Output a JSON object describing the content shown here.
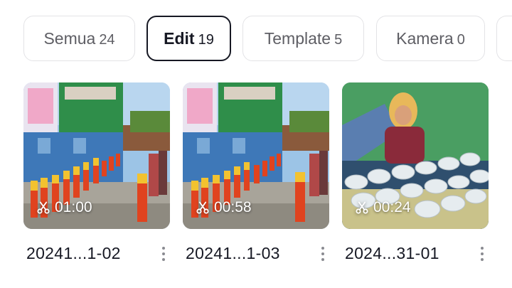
{
  "tabs": [
    {
      "label": "Semua",
      "count": "24",
      "active": false
    },
    {
      "label": "Edit",
      "count": "19",
      "active": true
    },
    {
      "label": "Template",
      "count": "5",
      "active": false
    },
    {
      "label": "Kamera",
      "count": "0",
      "active": false
    }
  ],
  "videos": [
    {
      "duration": "01:00",
      "name": "20241...1-02",
      "scene": "school-parade"
    },
    {
      "duration": "00:58",
      "name": "20241...1-03",
      "scene": "school-parade"
    },
    {
      "duration": "00:24",
      "name": "2024...31-01",
      "scene": "food-bowls"
    }
  ],
  "icons": {
    "duration": "scissors-icon",
    "menu": "more-vertical-icon"
  }
}
